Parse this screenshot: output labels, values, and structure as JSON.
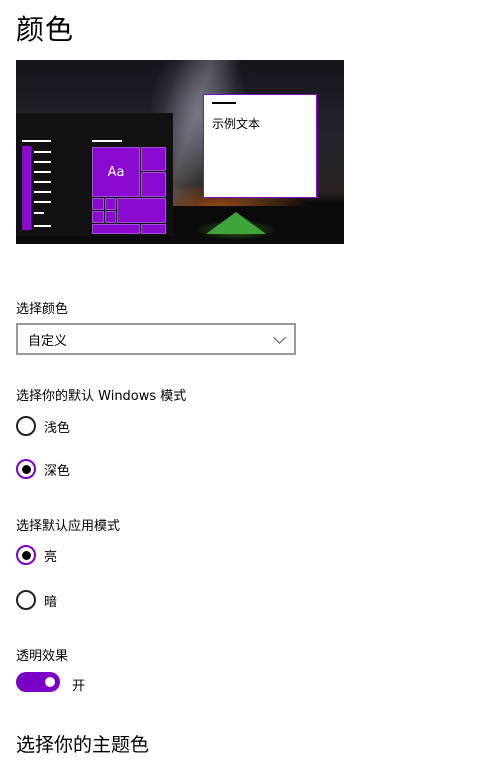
{
  "page": {
    "title": "颜色"
  },
  "preview": {
    "sample_text": "示例文本",
    "tile_text": "Aa",
    "accent_color": "#8a0ad0"
  },
  "color_select": {
    "label": "选择颜色",
    "value": "自定义",
    "icon": "chevron-down-icon"
  },
  "windows_mode": {
    "label": "选择你的默认 Windows 模式",
    "options": [
      {
        "label": "浅色",
        "checked": false
      },
      {
        "label": "深色",
        "checked": true
      }
    ]
  },
  "app_mode": {
    "label": "选择默认应用模式",
    "options": [
      {
        "label": "亮",
        "checked": true
      },
      {
        "label": "暗",
        "checked": false
      }
    ]
  },
  "transparency": {
    "label": "透明效果",
    "state_label": "开",
    "on": true,
    "toggle_color": "#7a00c8"
  },
  "accent_section": {
    "title": "选择你的主题色"
  }
}
